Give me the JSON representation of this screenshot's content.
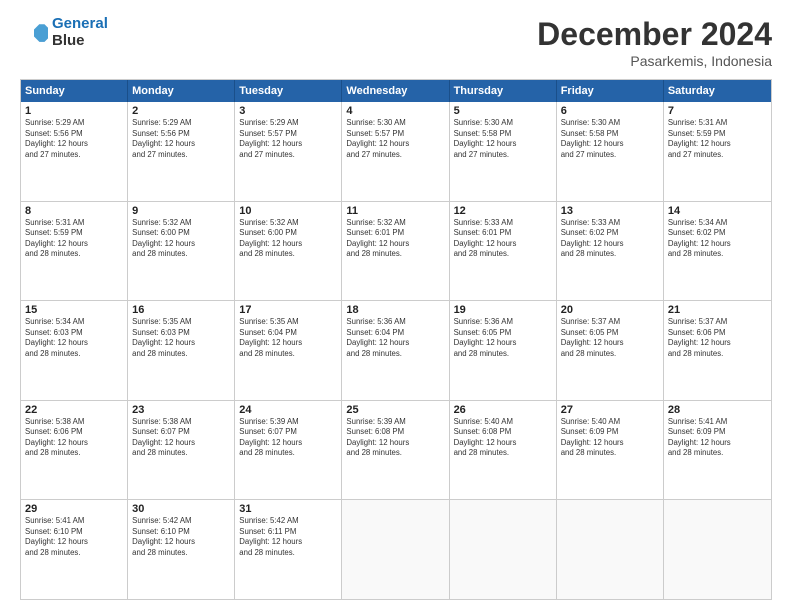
{
  "logo": {
    "line1": "General",
    "line2": "Blue"
  },
  "title": "December 2024",
  "subtitle": "Pasarkemis, Indonesia",
  "header_days": [
    "Sunday",
    "Monday",
    "Tuesday",
    "Wednesday",
    "Thursday",
    "Friday",
    "Saturday"
  ],
  "weeks": [
    [
      {
        "day": "1",
        "lines": [
          "Sunrise: 5:29 AM",
          "Sunset: 5:56 PM",
          "Daylight: 12 hours",
          "and 27 minutes."
        ]
      },
      {
        "day": "2",
        "lines": [
          "Sunrise: 5:29 AM",
          "Sunset: 5:56 PM",
          "Daylight: 12 hours",
          "and 27 minutes."
        ]
      },
      {
        "day": "3",
        "lines": [
          "Sunrise: 5:29 AM",
          "Sunset: 5:57 PM",
          "Daylight: 12 hours",
          "and 27 minutes."
        ]
      },
      {
        "day": "4",
        "lines": [
          "Sunrise: 5:30 AM",
          "Sunset: 5:57 PM",
          "Daylight: 12 hours",
          "and 27 minutes."
        ]
      },
      {
        "day": "5",
        "lines": [
          "Sunrise: 5:30 AM",
          "Sunset: 5:58 PM",
          "Daylight: 12 hours",
          "and 27 minutes."
        ]
      },
      {
        "day": "6",
        "lines": [
          "Sunrise: 5:30 AM",
          "Sunset: 5:58 PM",
          "Daylight: 12 hours",
          "and 27 minutes."
        ]
      },
      {
        "day": "7",
        "lines": [
          "Sunrise: 5:31 AM",
          "Sunset: 5:59 PM",
          "Daylight: 12 hours",
          "and 27 minutes."
        ]
      }
    ],
    [
      {
        "day": "8",
        "lines": [
          "Sunrise: 5:31 AM",
          "Sunset: 5:59 PM",
          "Daylight: 12 hours",
          "and 28 minutes."
        ]
      },
      {
        "day": "9",
        "lines": [
          "Sunrise: 5:32 AM",
          "Sunset: 6:00 PM",
          "Daylight: 12 hours",
          "and 28 minutes."
        ]
      },
      {
        "day": "10",
        "lines": [
          "Sunrise: 5:32 AM",
          "Sunset: 6:00 PM",
          "Daylight: 12 hours",
          "and 28 minutes."
        ]
      },
      {
        "day": "11",
        "lines": [
          "Sunrise: 5:32 AM",
          "Sunset: 6:01 PM",
          "Daylight: 12 hours",
          "and 28 minutes."
        ]
      },
      {
        "day": "12",
        "lines": [
          "Sunrise: 5:33 AM",
          "Sunset: 6:01 PM",
          "Daylight: 12 hours",
          "and 28 minutes."
        ]
      },
      {
        "day": "13",
        "lines": [
          "Sunrise: 5:33 AM",
          "Sunset: 6:02 PM",
          "Daylight: 12 hours",
          "and 28 minutes."
        ]
      },
      {
        "day": "14",
        "lines": [
          "Sunrise: 5:34 AM",
          "Sunset: 6:02 PM",
          "Daylight: 12 hours",
          "and 28 minutes."
        ]
      }
    ],
    [
      {
        "day": "15",
        "lines": [
          "Sunrise: 5:34 AM",
          "Sunset: 6:03 PM",
          "Daylight: 12 hours",
          "and 28 minutes."
        ]
      },
      {
        "day": "16",
        "lines": [
          "Sunrise: 5:35 AM",
          "Sunset: 6:03 PM",
          "Daylight: 12 hours",
          "and 28 minutes."
        ]
      },
      {
        "day": "17",
        "lines": [
          "Sunrise: 5:35 AM",
          "Sunset: 6:04 PM",
          "Daylight: 12 hours",
          "and 28 minutes."
        ]
      },
      {
        "day": "18",
        "lines": [
          "Sunrise: 5:36 AM",
          "Sunset: 6:04 PM",
          "Daylight: 12 hours",
          "and 28 minutes."
        ]
      },
      {
        "day": "19",
        "lines": [
          "Sunrise: 5:36 AM",
          "Sunset: 6:05 PM",
          "Daylight: 12 hours",
          "and 28 minutes."
        ]
      },
      {
        "day": "20",
        "lines": [
          "Sunrise: 5:37 AM",
          "Sunset: 6:05 PM",
          "Daylight: 12 hours",
          "and 28 minutes."
        ]
      },
      {
        "day": "21",
        "lines": [
          "Sunrise: 5:37 AM",
          "Sunset: 6:06 PM",
          "Daylight: 12 hours",
          "and 28 minutes."
        ]
      }
    ],
    [
      {
        "day": "22",
        "lines": [
          "Sunrise: 5:38 AM",
          "Sunset: 6:06 PM",
          "Daylight: 12 hours",
          "and 28 minutes."
        ]
      },
      {
        "day": "23",
        "lines": [
          "Sunrise: 5:38 AM",
          "Sunset: 6:07 PM",
          "Daylight: 12 hours",
          "and 28 minutes."
        ]
      },
      {
        "day": "24",
        "lines": [
          "Sunrise: 5:39 AM",
          "Sunset: 6:07 PM",
          "Daylight: 12 hours",
          "and 28 minutes."
        ]
      },
      {
        "day": "25",
        "lines": [
          "Sunrise: 5:39 AM",
          "Sunset: 6:08 PM",
          "Daylight: 12 hours",
          "and 28 minutes."
        ]
      },
      {
        "day": "26",
        "lines": [
          "Sunrise: 5:40 AM",
          "Sunset: 6:08 PM",
          "Daylight: 12 hours",
          "and 28 minutes."
        ]
      },
      {
        "day": "27",
        "lines": [
          "Sunrise: 5:40 AM",
          "Sunset: 6:09 PM",
          "Daylight: 12 hours",
          "and 28 minutes."
        ]
      },
      {
        "day": "28",
        "lines": [
          "Sunrise: 5:41 AM",
          "Sunset: 6:09 PM",
          "Daylight: 12 hours",
          "and 28 minutes."
        ]
      }
    ],
    [
      {
        "day": "29",
        "lines": [
          "Sunrise: 5:41 AM",
          "Sunset: 6:10 PM",
          "Daylight: 12 hours",
          "and 28 minutes."
        ]
      },
      {
        "day": "30",
        "lines": [
          "Sunrise: 5:42 AM",
          "Sunset: 6:10 PM",
          "Daylight: 12 hours",
          "and 28 minutes."
        ]
      },
      {
        "day": "31",
        "lines": [
          "Sunrise: 5:42 AM",
          "Sunset: 6:11 PM",
          "Daylight: 12 hours",
          "and 28 minutes."
        ]
      },
      {
        "day": "",
        "lines": []
      },
      {
        "day": "",
        "lines": []
      },
      {
        "day": "",
        "lines": []
      },
      {
        "day": "",
        "lines": []
      }
    ]
  ]
}
